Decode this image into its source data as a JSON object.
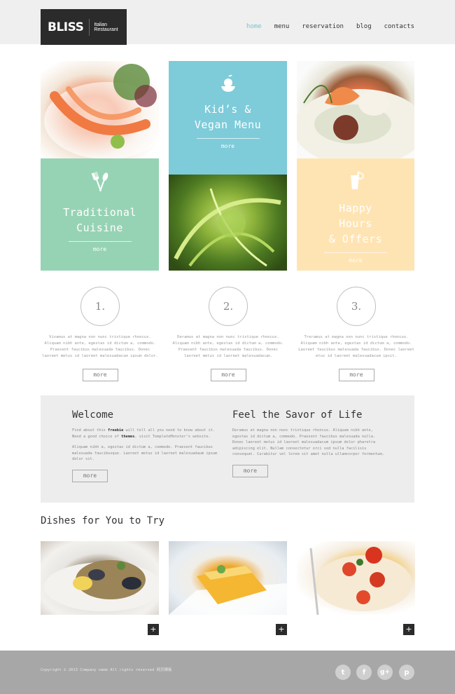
{
  "header": {
    "logo_name": "BLISS",
    "logo_tagline": "Italian Restaurant",
    "nav": [
      "home",
      "menu",
      "reservation",
      "blog",
      "contacts"
    ]
  },
  "tiles": {
    "kids": {
      "title_line1": "Kid’s &",
      "title_line2": "Vegan Menu",
      "more": "more",
      "color": "#7ecbd9"
    },
    "traditional": {
      "title_line1": "Traditional",
      "title_line2": "Cuisine",
      "more": "more",
      "color": "#96d3b4"
    },
    "happy": {
      "title_line1": "Happy",
      "title_line2": "Hours",
      "title_line3": "& Offers",
      "more": "more",
      "color": "#ffe4b3"
    }
  },
  "steps": [
    {
      "number": "1.",
      "text": "Vivamus at magna non nunc tristique rhoncus. Aliquam nibh ante, egestas id dictum a, commodo. Praesent faucibus malesuada faucibus. Donec laoreet metus id laoreet malesuadacum ipsum dolor.",
      "more": "more"
    },
    {
      "number": "2.",
      "text": "Deramus at magna non nunc tristique rhoncus. Aliquam nibh ante, egestas id dictum a, commodo. Praesent faucibus malesuada faucibus. Donec laoreet metus id laoreet malesuadacum.",
      "more": "more"
    },
    {
      "number": "3.",
      "text": "Treramus at magna non nunc tristique rhoncus. Aliquam nibh ante, egestas id dictum a, commodo. Laoreet faucibus malesuada faucibus. Donec laoreet etus id laoreet malesuadacum ipsit.",
      "more": "more"
    }
  ],
  "welcome": {
    "title": "Welcome",
    "p1_before": "Find about this ",
    "p1_bold1": "freebie",
    "p1_mid": " will tell all you need to know about it. Need a good choice of ",
    "p1_bold2": "themes",
    "p1_after": ", visit TemplateMonster’s website.",
    "p2": "Aliquam nibh a, egestas id dictum a, commodo. Praesent faucibus malesuada faucibusque. Laoreet metus id laoreet malesuadaum ipsum dolor sit.",
    "more": "more"
  },
  "savor": {
    "title": "Feel the Savor of Life",
    "text": "Deramus at magna non nunc tristique rhoncus. Aliquam nibh ante, egestas id dictum a, commodo. Praesent faucibus malesuada nulla. Donec laoreet metus id laoreet malesuadacum ipsum dolor pharetra adipiscing elit. Nullam consectetur orci sed nulla facilisis consequat. Curabitur vel lorem sit amet nulla ullamcorper fermentum.",
    "more": "more"
  },
  "dishes": {
    "title": "Dishes for You to Try",
    "plus": "+"
  },
  "footer": {
    "copyright": "Copyright © 2013 Company name All rights reserved 网页模板",
    "social": [
      {
        "icon": "twitter-icon",
        "glyph": "t"
      },
      {
        "icon": "facebook-icon",
        "glyph": "f"
      },
      {
        "icon": "google-plus-icon",
        "glyph": "g+"
      },
      {
        "icon": "pinterest-icon",
        "glyph": "p"
      }
    ]
  }
}
